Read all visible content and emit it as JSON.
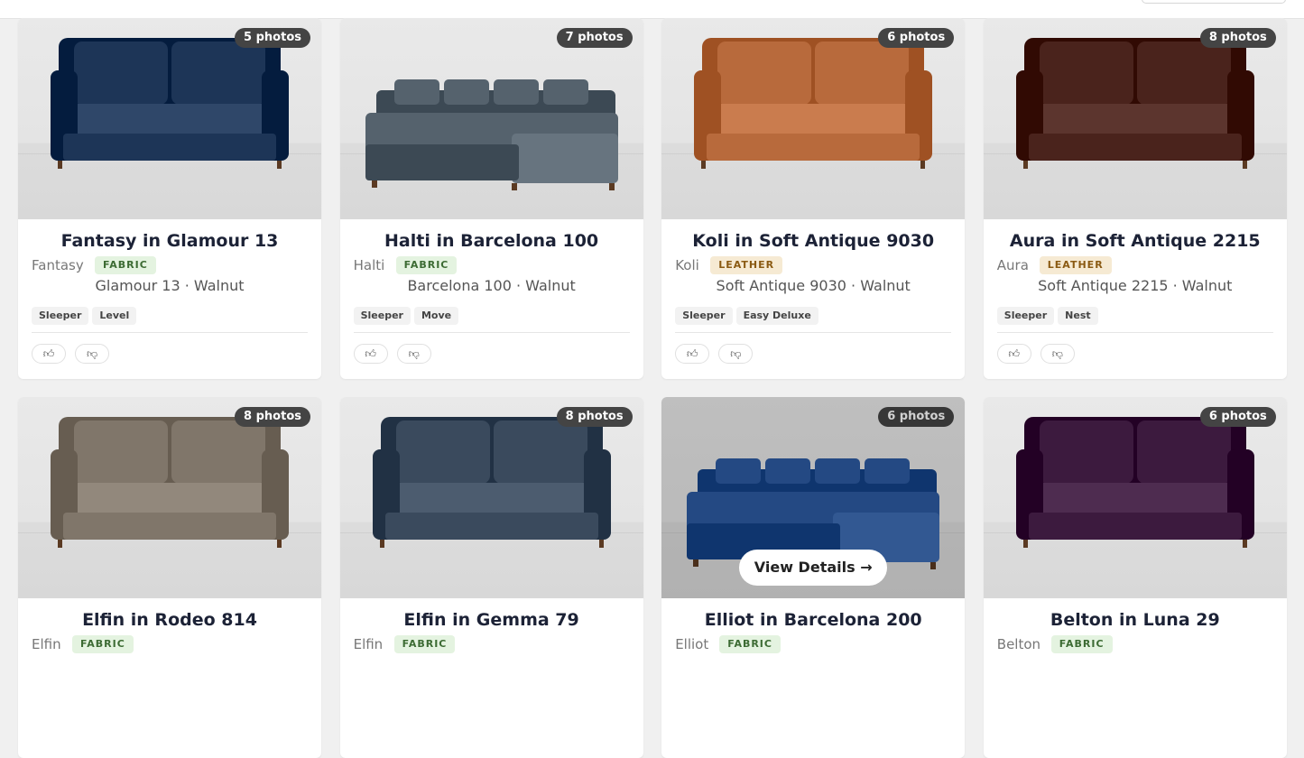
{
  "view_details_label": "View Details →",
  "cards": [
    {
      "count": "5 photos",
      "title": "Fantasy in Glamour 13",
      "brand": "Fantasy",
      "material": "FABRIC",
      "sub": "Glamour 13 · Walnut",
      "tags": [
        "Sleeper",
        "Level"
      ],
      "color": "#1d3557",
      "style": "loveseat",
      "shape": "sofa"
    },
    {
      "count": "7 photos",
      "title": "Halti in Barcelona 100",
      "brand": "Halti",
      "material": "FABRIC",
      "sub": "Barcelona 100 · Walnut",
      "tags": [
        "Sleeper",
        "Move"
      ],
      "color": "#55626d",
      "style": "sectional",
      "shape": "sectional"
    },
    {
      "count": "6 photos",
      "title": "Koli in Soft Antique 9030",
      "brand": "Koli",
      "material": "LEATHER",
      "sub": "Soft Antique 9030 · Walnut",
      "tags": [
        "Sleeper",
        "Easy Deluxe"
      ],
      "color": "#b86a3c",
      "style": "sofa",
      "shape": "sofa"
    },
    {
      "count": "8 photos",
      "title": "Aura in Soft Antique 2215",
      "brand": "Aura",
      "material": "LEATHER",
      "sub": "Soft Antique 2215 · Walnut",
      "tags": [
        "Sleeper",
        "Nest"
      ],
      "color": "#4a231c",
      "style": "sofa",
      "shape": "sofa"
    },
    {
      "count": "8 photos",
      "title": "Elfin in Rodeo 814",
      "brand": "Elfin",
      "material": "FABRIC",
      "color": "#80766a",
      "shape": "sofa"
    },
    {
      "count": "8 photos",
      "title": "Elfin in Gemma 79",
      "brand": "Elfin",
      "material": "FABRIC",
      "color": "#3a4a5d",
      "shape": "sofa"
    },
    {
      "count": "6 photos",
      "title": "Elliot in Barcelona 200",
      "brand": "Elliot",
      "material": "FABRIC",
      "color": "#2c5aa0",
      "shape": "sectional",
      "hover": true
    },
    {
      "count": "6 photos",
      "title": "Belton in Luna 29",
      "brand": "Belton",
      "material": "FABRIC",
      "color": "#3c1a3e",
      "shape": "sofa"
    }
  ]
}
